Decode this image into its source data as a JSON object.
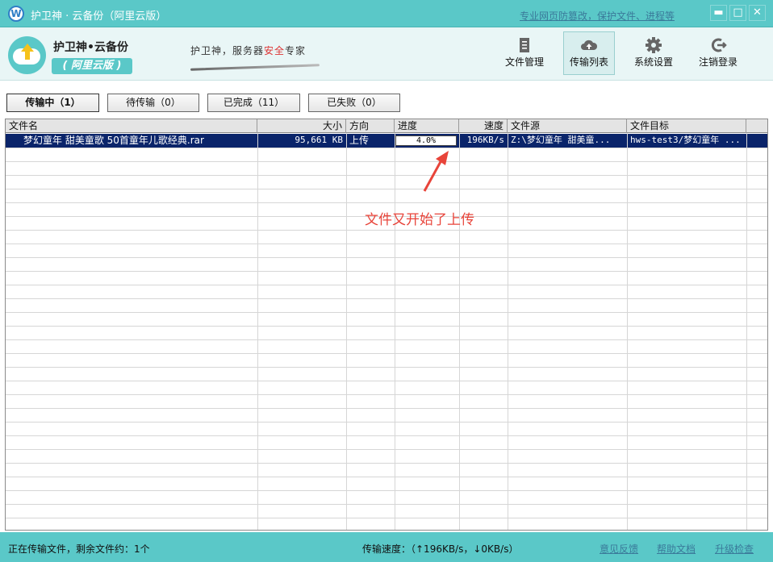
{
  "window": {
    "title": "护卫神 · 云备份（阿里云版）",
    "promo_link": "专业网页防篡改，保护文件、进程等",
    "controls": {
      "minimize": "▬",
      "maximize": "□",
      "close": "✕"
    }
  },
  "header": {
    "brand_name": "护卫神•云备份",
    "brand_badge": "( 阿里云版 )",
    "slogan_prefix": "护卫神，服务器",
    "slogan_highlight": "安全",
    "slogan_suffix": "专家",
    "toolbar": [
      {
        "label": "文件管理",
        "icon": "document-icon"
      },
      {
        "label": "传输列表",
        "icon": "cloud-upload-icon",
        "active": true
      },
      {
        "label": "系统设置",
        "icon": "gear-icon"
      },
      {
        "label": "注销登录",
        "icon": "logout-icon"
      }
    ]
  },
  "tabs": [
    {
      "label": "传输中（1）",
      "active": true
    },
    {
      "label": "待传输（0）"
    },
    {
      "label": "已完成（11）"
    },
    {
      "label": "已失败（0）"
    }
  ],
  "table": {
    "columns": [
      "文件名",
      "大小",
      "方向",
      "进度",
      "速度",
      "文件源",
      "文件目标"
    ],
    "rows": [
      {
        "name": "梦幻童年 甜美童歌 50首童年儿歌经典.rar",
        "size": "95,661 KB",
        "direction": "上传",
        "progress": "4.0%",
        "speed": "196KB/s",
        "source": "Z:\\梦幻童年 甜美童...",
        "target": "hws-test3/梦幻童年 ..."
      }
    ]
  },
  "annotation": "文件又开始了上传",
  "statusbar": {
    "left": "正在传输文件，剩余文件约：1个",
    "speed": "传输速度：（↑196KB/s，↓0KB/s）",
    "links": [
      "意见反馈",
      "帮助文档",
      "升级检查"
    ]
  },
  "colors": {
    "accent": "#5ac8c8",
    "selection": "#0a246a",
    "annotation": "#e8443a"
  }
}
